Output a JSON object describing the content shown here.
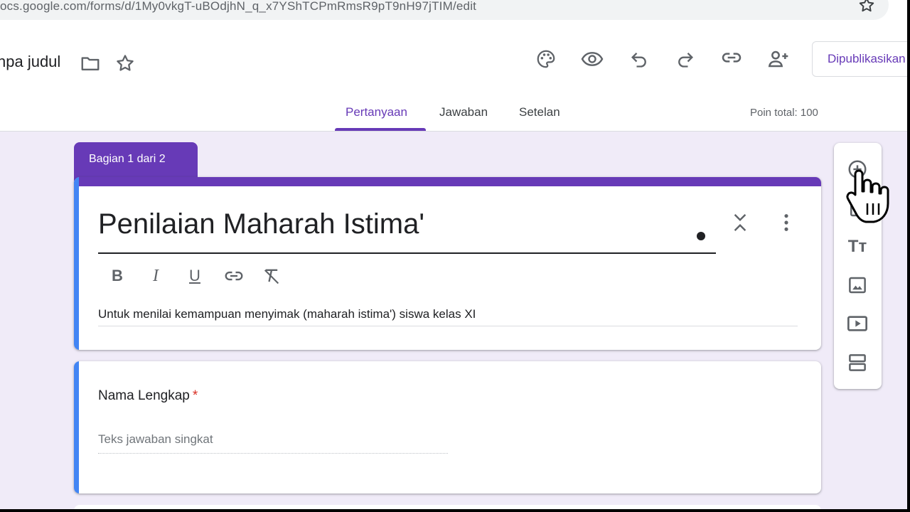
{
  "browser": {
    "url": "ocs.google.com/forms/d/1My0vkgT-uBOdjhN_q_x7YShTCPmRmsR9pT9nH97jTIM/edit"
  },
  "header": {
    "doc_title": "npa judul",
    "publish_label": "Dipublikasikan",
    "icons": [
      "palette-icon",
      "eye-icon",
      "undo-icon",
      "redo-icon",
      "link-icon",
      "add-person-icon"
    ]
  },
  "tabs": [
    {
      "label": "Pertanyaan",
      "active": true
    },
    {
      "label": "Jawaban"
    },
    {
      "label": "Setelan"
    }
  ],
  "points_total": "Poin total: 100",
  "section": {
    "label": "Bagian 1 dari 2"
  },
  "form": {
    "title": "Penilaian Maharah Istima'",
    "description": "Untuk menilai kemampuan menyimak (maharah istima') siswa kelas XI",
    "format": {
      "bold": "B",
      "italic": "I",
      "underline": "U"
    }
  },
  "question": {
    "label": "Nama Lengkap",
    "required_mark": "*",
    "answer_placeholder": "Teks jawaban singkat"
  },
  "toolbar": {
    "title_icon_text": "Tт",
    "items": [
      "add-question-icon",
      "import-questions-icon",
      "add-title-icon",
      "add-image-icon",
      "add-video-icon",
      "add-section-icon"
    ]
  },
  "colors": {
    "accent": "#673ab7",
    "background": "#f0ebf8",
    "active_card": "#4285f4",
    "required": "#d93025"
  }
}
